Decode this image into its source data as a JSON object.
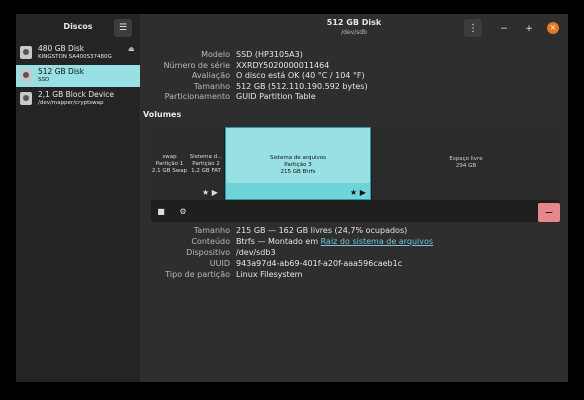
{
  "sidebar": {
    "title": "Discos",
    "menu_icon": "hamburger-menu-icon",
    "disks": [
      {
        "name": "480 GB Disk",
        "sub": "KINGSTON SA400S37480G",
        "selected": false,
        "icon": "drive-icon",
        "extra_icon": "eject-icon"
      },
      {
        "name": "512 GB Disk",
        "sub": "SSD",
        "selected": true,
        "icon": "drive-icon"
      },
      {
        "name": "2,1 GB Block Device",
        "sub": "/dev/mapper/cryptswap",
        "selected": false,
        "icon": "drive-icon"
      }
    ]
  },
  "header": {
    "title": "512 GB Disk",
    "subtitle": "/dev/sdb",
    "kebab": "⋮",
    "minimize": "−",
    "maximize": "+",
    "close": "×"
  },
  "disk_info": [
    {
      "label": "Modelo",
      "value": "SSD (HP3105A3)"
    },
    {
      "label": "Número de série",
      "value": "XXRDY5020000011464"
    },
    {
      "label": "Avaliação",
      "value": "O disco está OK (40 °C / 104 °F)"
    },
    {
      "label": "Tamanho",
      "value": "512 GB (512.110.190.592 bytes)"
    },
    {
      "label": "Particionamento",
      "value": "GUID Partition Table"
    }
  ],
  "volumes": {
    "title": "Volumes",
    "segments": [
      {
        "l1": "swap",
        "l2": "Partição 1",
        "l3": "2,1 GB Swap"
      },
      {
        "l1": "Sistema d...",
        "l2": "Partição 2",
        "l3": "1,2 GB FAT"
      },
      {
        "l1": "Sistema de arquivos",
        "l2": "Partição 3",
        "l3": "215 GB Btrfs"
      },
      {
        "l1": "Espaço livre",
        "l2": "294 GB"
      }
    ],
    "mount_mark": "★ ▶",
    "stop_icon": "■",
    "gears_icon": "⚙",
    "delete_label": "−"
  },
  "partition_info": {
    "size_label": "Tamanho",
    "size_value": "215 GB — 162 GB livres (24,7% ocupados)",
    "content_label": "Conteúdo",
    "content_prefix": "Btrfs — Montado em ",
    "content_link": "Raiz do sistema de arquivos",
    "device_label": "Dispositivo",
    "device_value": "/dev/sdb3",
    "uuid_label": "UUID",
    "uuid_value": "943a97d4-ab69-401f-a20f-aaa596caeb1c",
    "type_label": "Tipo de partição",
    "type_value": "Linux Filesystem"
  }
}
